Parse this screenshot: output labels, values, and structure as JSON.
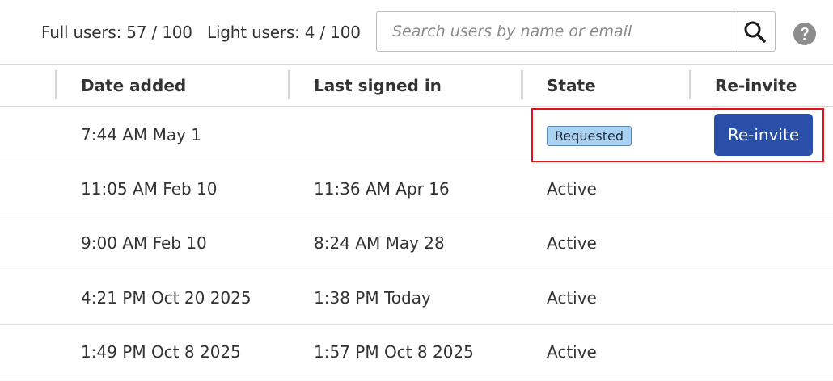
{
  "topbar": {
    "full_users": "Full users: 57 / 100",
    "light_users": "Light users: 4 / 100",
    "search": {
      "value": "",
      "placeholder": "Search users by name or email",
      "icon": "search-icon"
    },
    "help_icon": "question-circle-icon"
  },
  "table": {
    "columns": [
      "Date added",
      "Last signed in",
      "State",
      "Re-invite"
    ],
    "rows": [
      {
        "date_added": "7:44 AM May 1",
        "last_signed_in": "",
        "state": "Requested",
        "state_style": "badge",
        "reinvite_label": "Re-invite"
      },
      {
        "date_added": "11:05 AM Feb 10",
        "last_signed_in": "11:36 AM Apr 16",
        "state": "Active"
      },
      {
        "date_added": "9:00 AM Feb 10",
        "last_signed_in": "8:24 AM May 28",
        "state": "Active"
      },
      {
        "date_added": "4:21 PM Oct 20 2025",
        "last_signed_in": "1:38 PM Today",
        "state": "Active"
      },
      {
        "date_added": "1:49 PM Oct 8 2025",
        "last_signed_in": "1:57 PM Oct 8 2025",
        "state": "Active"
      }
    ]
  },
  "colors": {
    "primary_button": "#2a4fa8",
    "badge_bg": "#a9d2f2",
    "highlight": "#e0141b"
  }
}
